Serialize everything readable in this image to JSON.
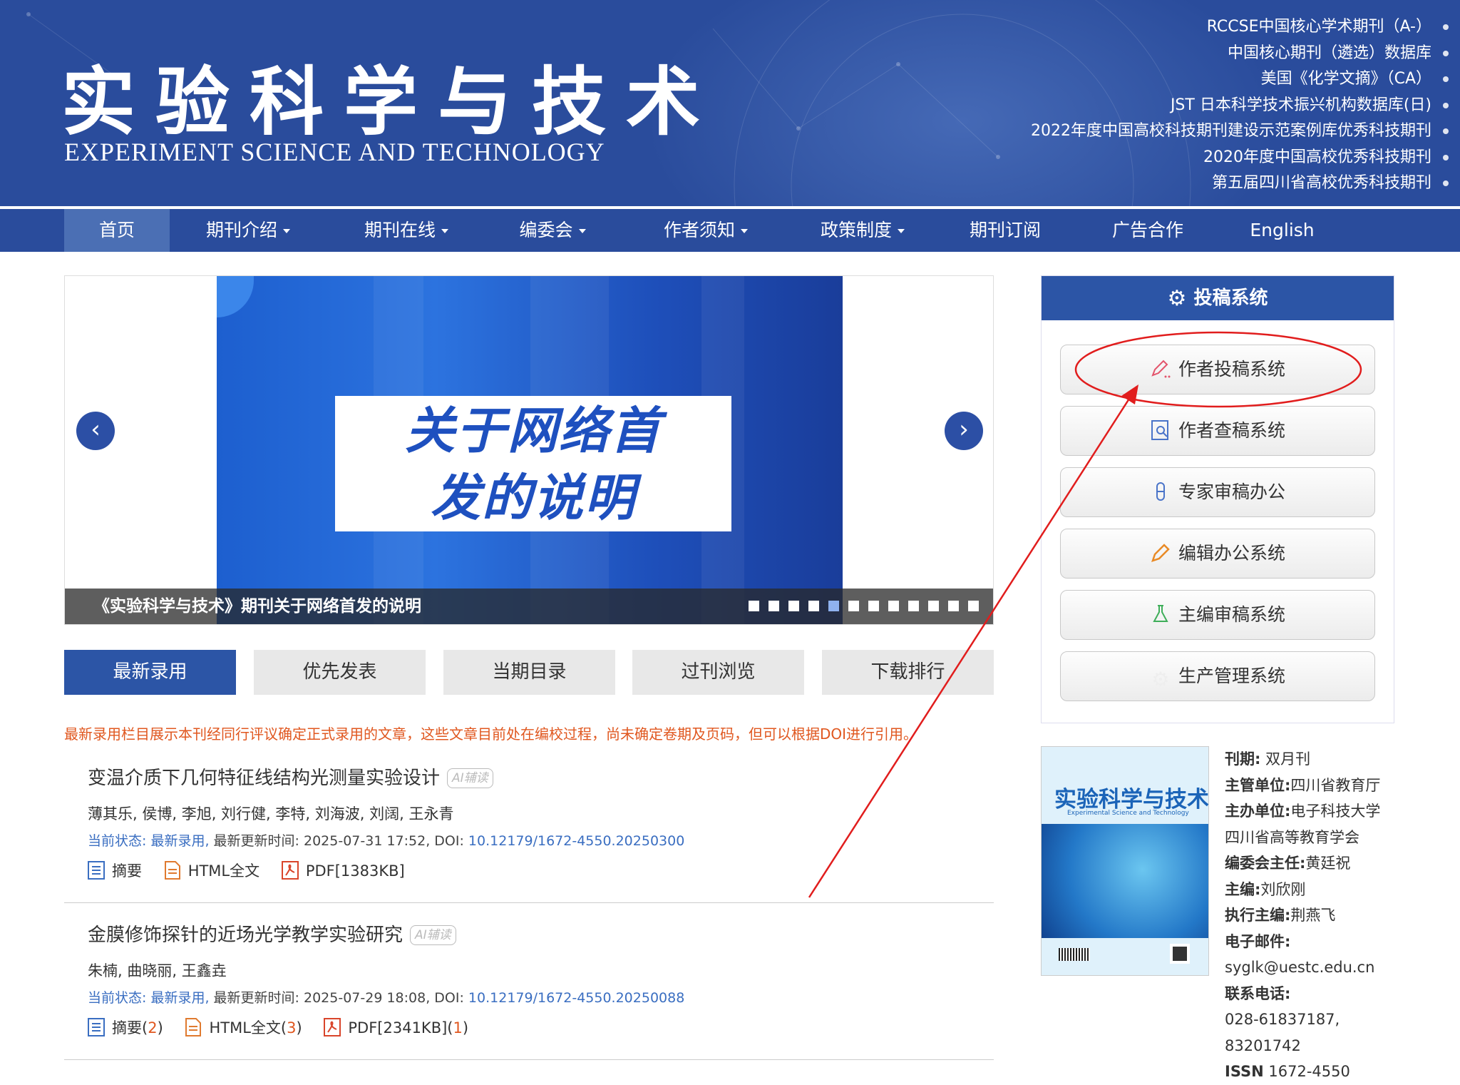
{
  "header": {
    "title_cn": "实验科学与技术",
    "title_en": "EXPERIMENT SCIENCE AND TECHNOLOGY",
    "honors": [
      "RCCSE中国核心学术期刊（A-）",
      "中国核心期刊（遴选）数据库",
      "美国《化学文摘》（CA）",
      "JST 日本科学技术振兴机构数据库(日)",
      "2022年度中国高校科技期刊建设示范案例库优秀科技期刊",
      "2020年度中国高校优秀科技期刊",
      "第五届四川省高校优秀科技期刊"
    ]
  },
  "nav": {
    "items": [
      {
        "label": "首页",
        "dropdown": false,
        "active": true
      },
      {
        "label": "期刊介绍",
        "dropdown": true
      },
      {
        "label": "期刊在线",
        "dropdown": true
      },
      {
        "label": "编委会",
        "dropdown": true
      },
      {
        "label": "作者须知",
        "dropdown": true
      },
      {
        "label": "政策制度",
        "dropdown": true
      },
      {
        "label": "期刊订阅",
        "dropdown": false
      },
      {
        "label": "广告合作",
        "dropdown": false
      },
      {
        "label": "English",
        "dropdown": false
      }
    ]
  },
  "carousel": {
    "slide_line1": "关于网络首",
    "slide_line2": "发的说明",
    "caption": "《实验科学与技术》期刊关于网络首发的说明",
    "prev_icon": "chevron-left-icon",
    "next_icon": "chevron-right-icon",
    "dot_count": 12,
    "active_dot": 5
  },
  "tabs": [
    "最新录用",
    "优先发表",
    "当期目录",
    "过刊浏览",
    "下载排行"
  ],
  "notice": "最新录用栏目展示本刊经同行评议确定正式录用的文章，这些文章目前处在编校过程，尚未确定卷期及页码，但可以根据DOI进行引用。",
  "articles": [
    {
      "title": "变温介质下几何特征线结构光测量实验设计",
      "ai_badge": "AI辅读",
      "authors": "薄其乐, 侯博, 李旭, 刘行健, 李特, 刘海波, 刘阔, 王永青",
      "status_label": "当前状态:",
      "status_value": "最新录用,",
      "updated": "最新更新时间: 2025-07-31 17:52, DOI:",
      "doi": "10.12179/1672-4550.20250300",
      "abstract_label": "摘要",
      "abstract_count": "",
      "html_label": "HTML全文",
      "html_count": "",
      "pdf_label": "PDF[1383KB]",
      "pdf_count": ""
    },
    {
      "title": "金膜修饰探针的近场光学教学实验研究",
      "ai_badge": "AI辅读",
      "authors": "朱楠, 曲晓丽, 王鑫垚",
      "status_label": "当前状态:",
      "status_value": "最新录用,",
      "updated": "最新更新时间: 2025-07-29 18:08, DOI:",
      "doi": "10.12179/1672-4550.20250088",
      "abstract_label": "摘要(",
      "abstract_count": "2",
      "html_label": "HTML全文(",
      "html_count": "3",
      "pdf_label": "PDF[2341KB](",
      "pdf_count": "1"
    }
  ],
  "submission": {
    "heading": "投稿系统",
    "heading_icon": "gear-icon",
    "buttons": [
      {
        "label": "作者投稿系统",
        "icon": "pen-icon"
      },
      {
        "label": "作者查稿系统",
        "icon": "search-doc-icon"
      },
      {
        "label": "专家审稿办公",
        "icon": "test-tube-icon"
      },
      {
        "label": "编辑办公系统",
        "icon": "pencil-icon"
      },
      {
        "label": "主编审稿系统",
        "icon": "flask-icon"
      },
      {
        "label": "生产管理系统",
        "icon": "gear-icon"
      }
    ]
  },
  "journal_info": {
    "cover_title": "实验科学与技术",
    "cover_subtitle": "Experimental Science and Technology",
    "lines": [
      {
        "k": "刊期:",
        "v": "双月刊"
      },
      {
        "k": "主管单位:",
        "v": "四川省教育厅"
      },
      {
        "k": "主办单位:",
        "v": "电子科技大学"
      },
      {
        "k": "",
        "v": "四川省高等教育学会"
      },
      {
        "k": "编委会主任:",
        "v": "黄廷祝"
      },
      {
        "k": "主编:",
        "v": "刘欣刚"
      },
      {
        "k": "执行主编:",
        "v": "荆燕飞"
      },
      {
        "k": "电子邮件:",
        "v": ""
      },
      {
        "k": "",
        "v": "syglk@uestc.edu.cn"
      },
      {
        "k": "联系电话:",
        "v": ""
      },
      {
        "k": "",
        "v": "028-61837187,"
      },
      {
        "k": "",
        "v": "83201742"
      },
      {
        "k": "ISSN",
        "v": "1672-4550"
      }
    ]
  },
  "colors": {
    "brand": "#2a4c9c",
    "accent_orange": "#e0571f",
    "link": "#3a6ec1",
    "annotation": "#e11d1d"
  }
}
